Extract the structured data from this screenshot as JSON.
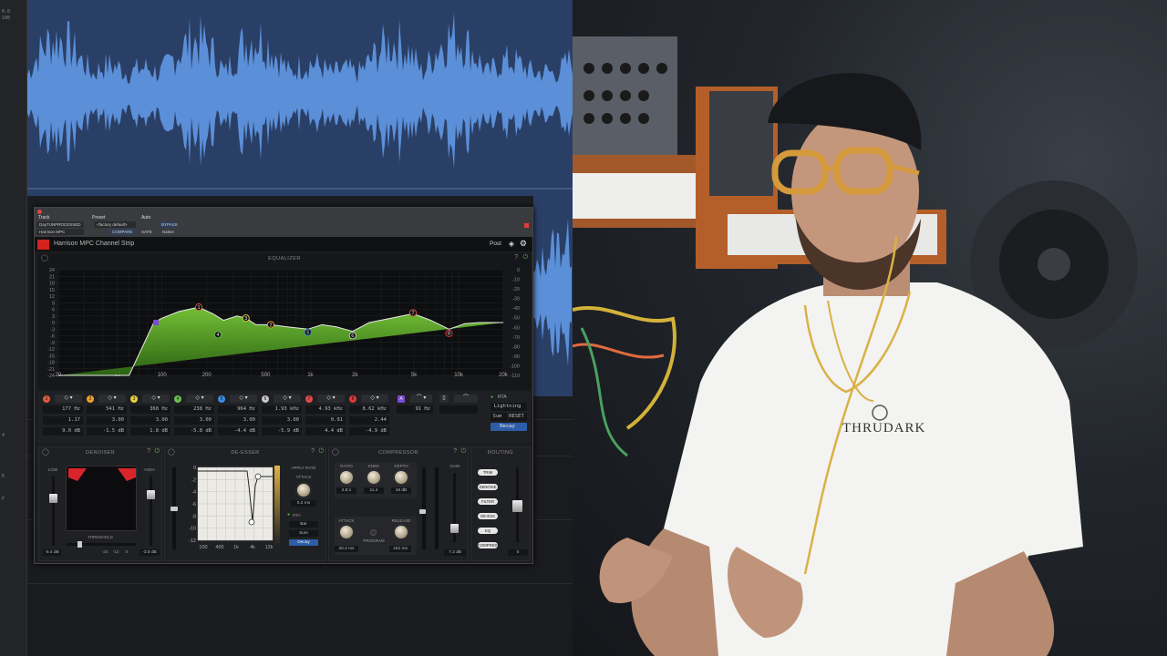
{
  "daw": {
    "mini_labels": [
      "0.0",
      "100"
    ],
    "side_labels": [
      "4",
      "E",
      "F"
    ]
  },
  "plugin": {
    "header": {
      "track_label": "Track",
      "preset_label": "Preset",
      "auto_label": "Auto",
      "track_name": "DayTUNPROCESSED",
      "preset_value": "<factory default>",
      "plugin_slot": "Harrison MPC Channel Strip",
      "compare_label": "COMPARE",
      "safe_label": "SAFE",
      "native_label": "Native",
      "bypass_label": "BYPASS"
    },
    "brand": "Harrison MPC Channel Strip",
    "post_label": "Post",
    "equalizer": {
      "title": "EQUALIZER",
      "db_left": [
        "24",
        "21",
        "18",
        "15",
        "12",
        "9",
        "6",
        "3",
        "0",
        "-3",
        "-6",
        "-9",
        "-12",
        "-15",
        "-18",
        "-21",
        "-24"
      ],
      "db_right": [
        "0",
        "-10",
        "-20",
        "-30",
        "-40",
        "-50",
        "-60",
        "-70",
        "-80",
        "-90",
        "-100",
        "-110"
      ],
      "freq_labels": [
        "20",
        "50",
        "100",
        "200",
        "500",
        "1k",
        "2k",
        "5k",
        "10k",
        "20k"
      ],
      "bands": [
        {
          "num": "1",
          "freq": "177 Hz",
          "q": "1.17",
          "gain": "9.0 dB",
          "color": "#e05a3a"
        },
        {
          "num": "2",
          "freq": "541 Hz",
          "q": "3.00",
          "gain": "-1.5 dB",
          "color": "#f0a030"
        },
        {
          "num": "3",
          "freq": "368 Hz",
          "q": "3.00",
          "gain": "1.8 dB",
          "color": "#e8d040"
        },
        {
          "num": "4",
          "freq": "238 Hz",
          "q": "3.00",
          "gain": "-5.8 dB",
          "color": "#6ac04a"
        },
        {
          "num": "5",
          "freq": "964 Hz",
          "q": "3.00",
          "gain": "-4.4 dB",
          "color": "#3a8ee0"
        },
        {
          "num": "6",
          "freq": "1.93 kHz",
          "q": "3.00",
          "gain": "-5.9 dB",
          "color": "#c8c8c8"
        },
        {
          "num": "7",
          "freq": "4.93 kHz",
          "q": "0.91",
          "gain": "4.4 dB",
          "color": "#e04a4a"
        },
        {
          "num": "8",
          "freq": "8.62 kHz",
          "q": "2.44",
          "gain": "-4.9 dB",
          "color": "#e03a3a"
        }
      ],
      "hpf": {
        "tag": "A",
        "freq": "91 Hz"
      },
      "rta": {
        "label": "RTA",
        "mode": "Lightning",
        "type": "Sum",
        "reset": "RESET",
        "decay": "Decay"
      }
    },
    "denoiser": {
      "title": "DENOISER",
      "low": "LOW",
      "high": "HIGH",
      "threshold": "THRESHOLD",
      "low_val": "-5.4 dB",
      "high_val": "-3.8 dB",
      "scale": [
        "-24",
        "-12",
        "0"
      ]
    },
    "deesser": {
      "title": "DE-ESSER",
      "y_labels": [
        "0",
        "-2",
        "-4",
        "-6",
        "-8",
        "-10",
        "-12"
      ],
      "x_labels": [
        "100",
        "400",
        "1k",
        "4k",
        "12k"
      ],
      "apply_label": "APPLY RATE",
      "attack_label": "ATTACK",
      "attack_val": "0.2 ms",
      "rta_label": "RTA",
      "rta_mode": "Bar",
      "rta_type": "Sum",
      "decay": "Decay"
    },
    "compressor": {
      "title": "COMPRESSOR",
      "ratio_label": "RATIO",
      "ratio_val": "2.8:1",
      "knee_label": "KNEE",
      "knee_val": "11.4",
      "depth_label": "DEPTH",
      "depth_val": "18 dB",
      "attack_label": "ATTACK",
      "attack_val": "26.4 ms",
      "release_label": "RELEASE",
      "release_val": "152 ms",
      "program_label": "PROGRAM",
      "gain_label": "GAIN",
      "gain_val": "7.3 dB"
    },
    "routing": {
      "title": "ROUTING",
      "buttons": [
        "TRIM",
        "DENOISE",
        "FILTER",
        "DE-ESS",
        "EQ",
        "COMPRESS"
      ],
      "out_label": "0"
    }
  },
  "camera": {
    "shirt_text": "THRUDARK"
  }
}
